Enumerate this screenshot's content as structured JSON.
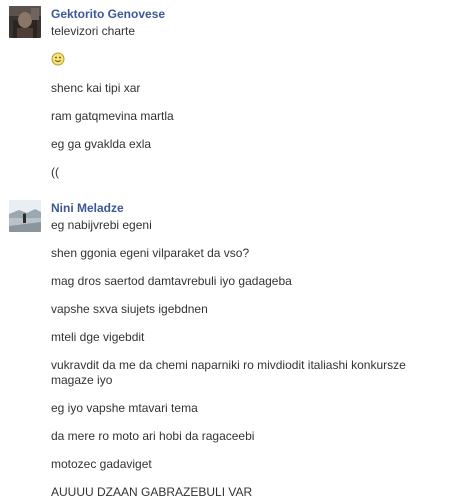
{
  "conversation": {
    "groups": [
      {
        "sender": "Gektorito Genovese",
        "messages": [
          "televizori charte",
          "",
          "shenc kai tipi xar",
          "ram gatqmevina martla",
          "eg ga gvaklda exla",
          "(("
        ],
        "emoji_icon": "smiley-icon"
      },
      {
        "sender": "Nini Meladze",
        "messages": [
          "eg nabijvrebi egeni",
          "shen ggonia egeni vilparaket da vso?",
          "mag dros saertod damtavrebuli iyo gadageba",
          "vapshe sxva siujets igebdnen",
          "mteli dge vigebdit",
          "vukravdit da me da chemi naparniki ro mivdiodit italiashi konkursze magaze iyo",
          "eg iyo vapshe mtavari tema",
          "da mere ro moto ari hobi da ragaceebi",
          "motozec gadaviget",
          "AUUUU DZAAN GABRAZEBULI VAR"
        ]
      }
    ]
  },
  "colors": {
    "sender_link": "#3b5998",
    "message_text": "#333333",
    "background": "#ffffff"
  }
}
